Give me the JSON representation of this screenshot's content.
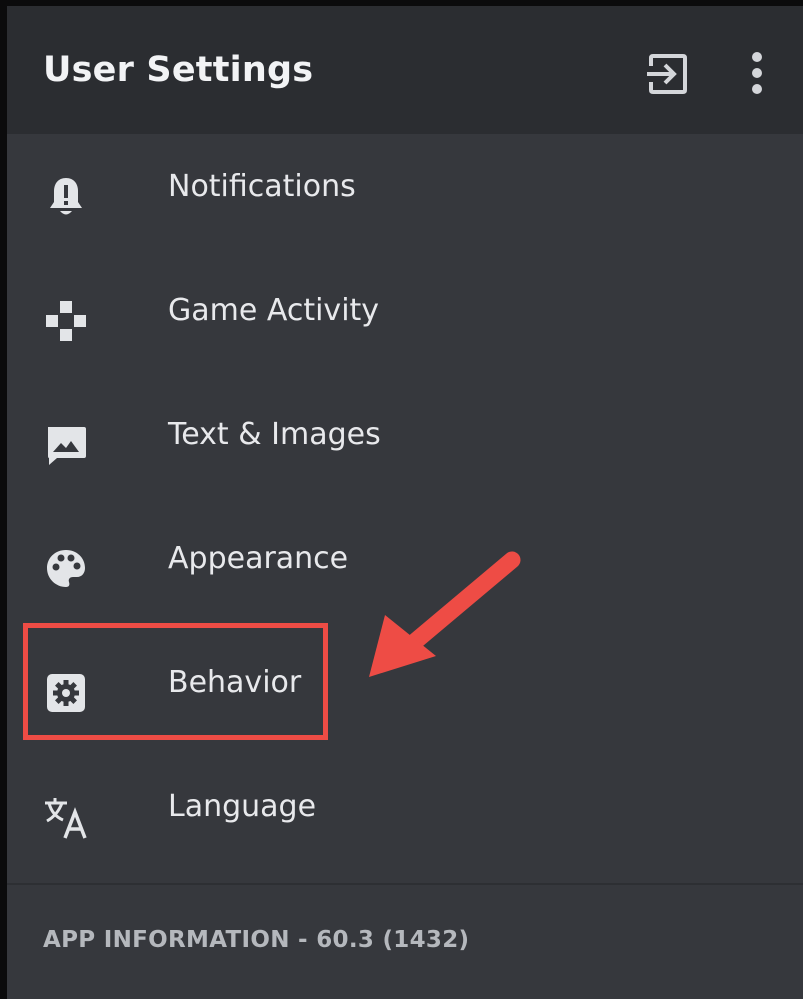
{
  "header": {
    "title": "User Settings",
    "actions": [
      {
        "icon": "logout-icon"
      },
      {
        "icon": "more-vertical-icon"
      }
    ]
  },
  "menu": {
    "items": [
      {
        "label": "Notifications",
        "icon": "bell-icon"
      },
      {
        "label": "Game Activity",
        "icon": "gamepad-icon"
      },
      {
        "label": "Text & Images",
        "icon": "image-icon"
      },
      {
        "label": "Appearance",
        "icon": "palette-icon"
      },
      {
        "label": "Behavior",
        "icon": "settings-gear-icon",
        "highlighted": true
      },
      {
        "label": "Language",
        "icon": "translate-icon"
      }
    ]
  },
  "footer": {
    "section_label": "APP INFORMATION - 60.3 (1432)"
  },
  "colors": {
    "background": "#36383d",
    "header_background": "#2b2d31",
    "text": "#e8e9ec",
    "muted_text": "#b5b8bd",
    "annotation_red": "#ee4c45"
  }
}
